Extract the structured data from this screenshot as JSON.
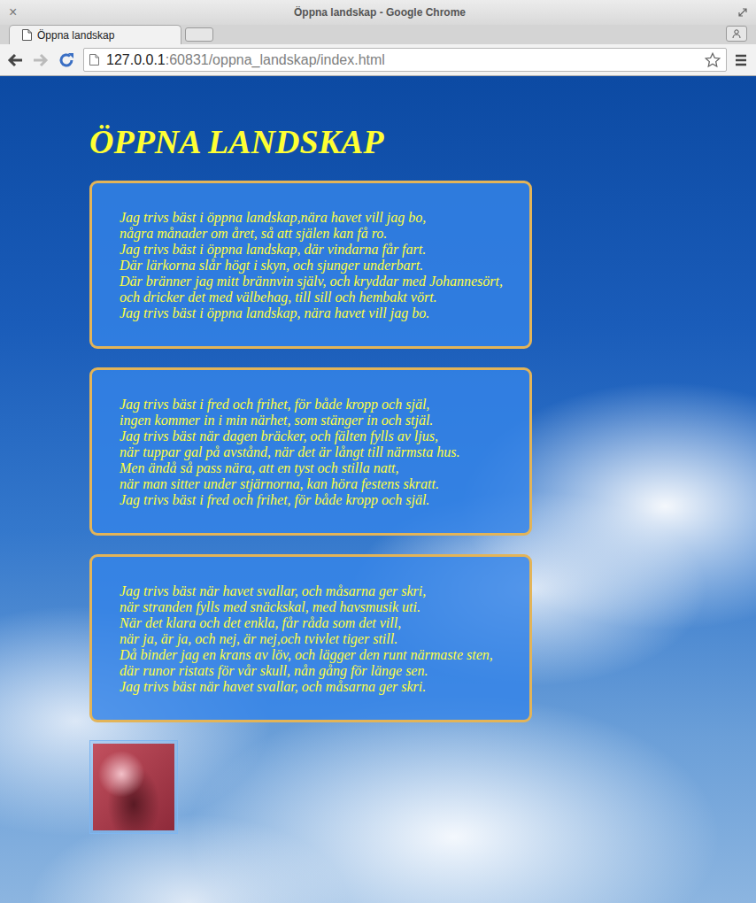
{
  "window": {
    "title": "Öppna landskap - Google Chrome",
    "close": "×"
  },
  "tabs": [
    {
      "label": "Öppna landskap",
      "selected": true
    }
  ],
  "address_bar": {
    "host": "127.0.0.1",
    "rest": ":60831/oppna_landskap/index.html"
  },
  "page": {
    "heading": "ÖPPNA LANDSKAP",
    "stanzas": [
      [
        "Jag trivs bäst i öppna landskap,nära havet vill jag bo,",
        "några månader om året, så att själen kan få ro.",
        "Jag trivs bäst i öppna landskap, där vindarna får fart.",
        "Där lärkorna slår högt i skyn, och sjunger underbart.",
        "Där bränner jag mitt brännvin själv, och kryddar med Johannesört,",
        "och dricker det med välbehag, till sill och hembakt vört.",
        "Jag trivs bäst i öppna landskap, nära havet vill jag bo."
      ],
      [
        "Jag trivs bäst i fred och frihet, för både kropp och själ,",
        "ingen kommer in i min närhet, som stänger in och stjäl.",
        "Jag trivs bäst när dagen bräcker, och fälten fylls av ljus,",
        "när tuppar gal på avstånd, när det är långt till närmsta hus.",
        "Men ändå så pass nära, att en tyst och stilla natt,",
        "när man sitter under stjärnorna, kan höra festens skratt.",
        "Jag trivs bäst i fred och frihet, för både kropp och själ."
      ],
      [
        "Jag trivs bäst när havet svallar, och måsarna ger skri,",
        "när stranden fylls med snäckskal, med havsmusik uti.",
        "När det klara och det enkla, får råda som det vill,",
        "när ja, är ja, och nej, är nej,och tvivlet tiger still.",
        "Då binder jag en krans av löv, och lägger den runt närmaste sten,",
        "där runor ristats för vår skull, nån gång för länge sen.",
        "Jag trivs bäst när havet svallar, och måsarna ger skri."
      ]
    ]
  }
}
